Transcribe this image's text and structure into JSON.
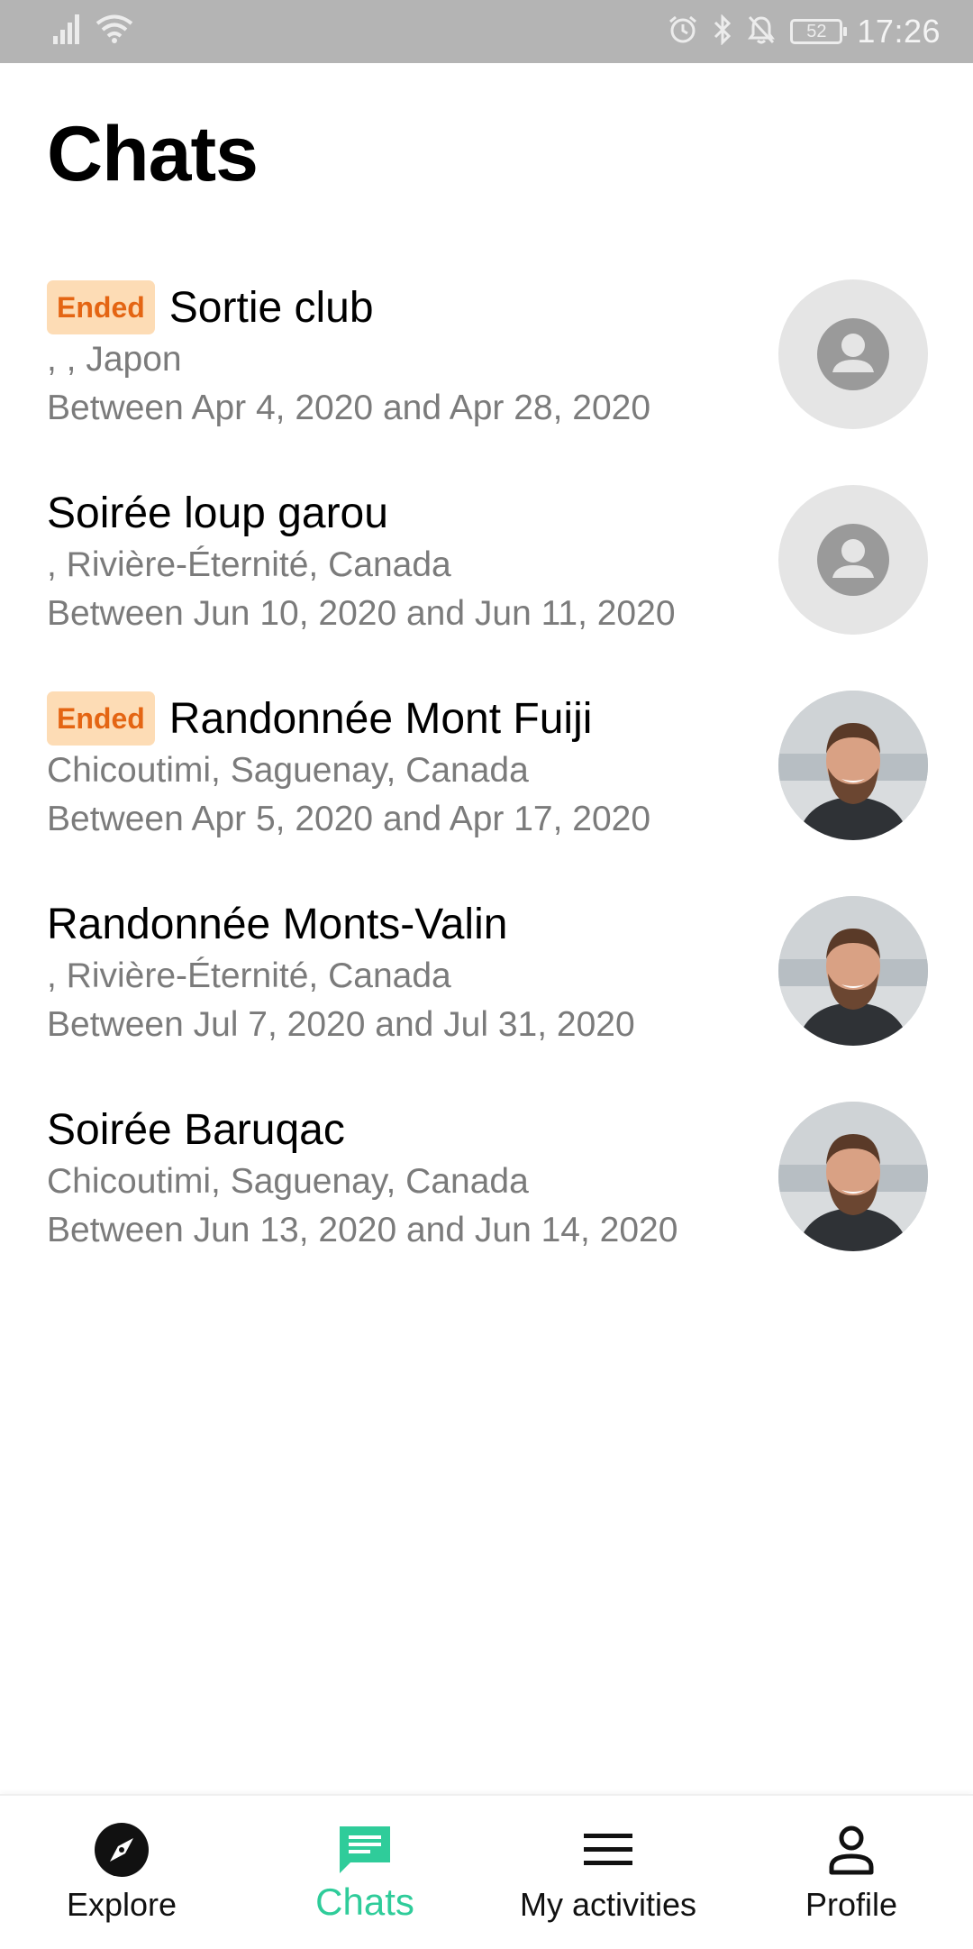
{
  "status_bar": {
    "battery": "52",
    "time": "17:26"
  },
  "page": {
    "title": "Chats"
  },
  "chats": [
    {
      "badge": "Ended",
      "title": "Sortie club",
      "location": ", , Japon",
      "dates": "Between Apr 4, 2020 and Apr 28, 2020",
      "avatar": "person-placeholder-icon"
    },
    {
      "badge": "",
      "title": "Soirée loup garou",
      "location": ", Rivière-Éternité, Canada",
      "dates": "Between Jun 10, 2020 and Jun 11, 2020",
      "avatar": "person-placeholder-icon"
    },
    {
      "badge": "Ended",
      "title": "Randonnée Mont Fuiji",
      "location": "Chicoutimi, Saguenay, Canada",
      "dates": "Between Apr 5, 2020 and Apr 17, 2020",
      "avatar": "user-photo"
    },
    {
      "badge": "",
      "title": "Randonnée Monts-Valin",
      "location": ", Rivière-Éternité, Canada",
      "dates": "Between Jul 7, 2020 and Jul 31, 2020",
      "avatar": "user-photo"
    },
    {
      "badge": "",
      "title": "Soirée Baruqac",
      "location": "Chicoutimi, Saguenay, Canada",
      "dates": "Between Jun 13, 2020 and Jun 14, 2020",
      "avatar": "user-photo"
    }
  ],
  "bottom_nav": {
    "explore": "Explore",
    "chats": "Chats",
    "my_activities": "My activities",
    "profile": "Profile"
  },
  "colors": {
    "accent": "#2fcc9a",
    "badge_bg": "#fddcb5",
    "badge_text": "#e46513",
    "secondary_text": "#7b7b7b",
    "status_bar_bg": "#b4b4b4"
  }
}
